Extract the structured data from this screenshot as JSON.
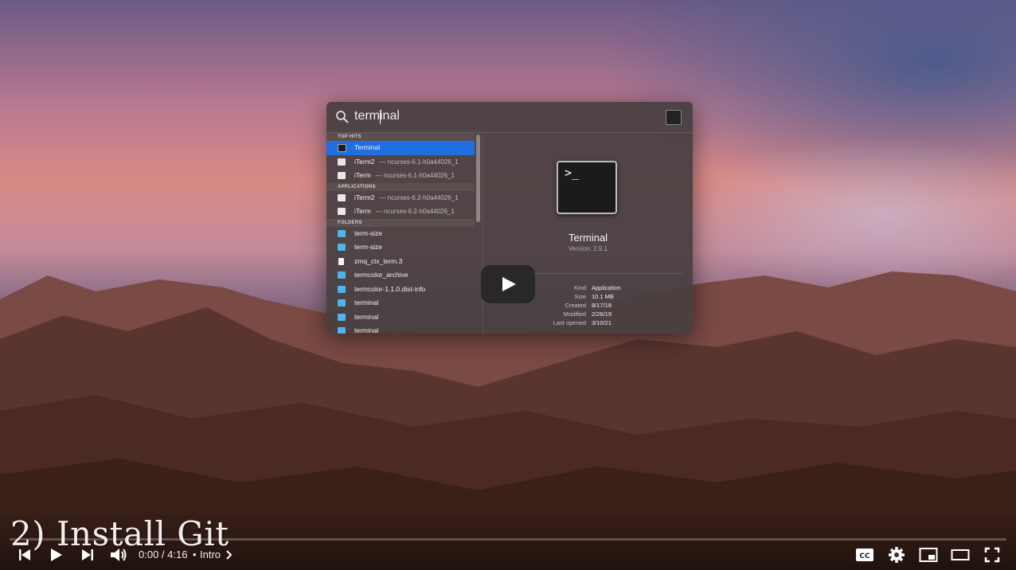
{
  "spotlight": {
    "query": "terminal",
    "sections": [
      {
        "title": "TOP HITS",
        "items": [
          {
            "name": "Terminal",
            "sub": "",
            "icon": "terminal-app-icon",
            "selected": true
          },
          {
            "name": "iTerm2",
            "sub": "— ncurses-6.1-h0a44026_1",
            "icon": "iterm2-app-icon"
          },
          {
            "name": "iTerm",
            "sub": "— ncurses-6.1-h0a44026_1",
            "icon": "iterm-app-icon"
          }
        ]
      },
      {
        "title": "APPLICATIONS",
        "items": [
          {
            "name": "iTerm2",
            "sub": "— ncurses-6.2-h0a44026_1",
            "icon": "iterm2-app-icon"
          },
          {
            "name": "iTerm",
            "sub": "— ncurses-6.2-h0a44026_1",
            "icon": "iterm-app-icon"
          }
        ]
      },
      {
        "title": "FOLDERS",
        "items": [
          {
            "name": "term-size",
            "sub": "",
            "icon": "folder-icon"
          },
          {
            "name": "term-size",
            "sub": "",
            "icon": "folder-icon"
          },
          {
            "name": "zmq_ctx_term.3",
            "sub": "",
            "icon": "document-icon"
          },
          {
            "name": "termcolor_archive",
            "sub": "",
            "icon": "folder-icon"
          },
          {
            "name": "termcolor-1.1.0.dist-info",
            "sub": "",
            "icon": "folder-icon"
          },
          {
            "name": "terminal",
            "sub": "",
            "icon": "folder-icon"
          },
          {
            "name": "terminal",
            "sub": "",
            "icon": "folder-icon"
          },
          {
            "name": "terminal",
            "sub": "",
            "icon": "folder-icon"
          }
        ]
      }
    ],
    "detail": {
      "name": "Terminal",
      "version": "Version: 2.9.1",
      "prompt": ">_",
      "fields": [
        {
          "key": "Kind",
          "value": "Application"
        },
        {
          "key": "Size",
          "value": "10.1 MB"
        },
        {
          "key": "Created",
          "value": "8/17/18"
        },
        {
          "key": "Modified",
          "value": "2/26/19"
        },
        {
          "key": "Last opened",
          "value": "3/10/21"
        }
      ]
    }
  },
  "video": {
    "caption": "2) Install Git",
    "time": "0:00 / 4:16",
    "separator": "•",
    "chapter": "Intro",
    "progress": 0.0,
    "controls": [
      "previous-icon",
      "play-icon",
      "next-icon",
      "volume-icon",
      "subtitles-icon",
      "settings-gear-icon",
      "miniplayer-icon",
      "theater-mode-icon",
      "fullscreen-icon"
    ]
  }
}
